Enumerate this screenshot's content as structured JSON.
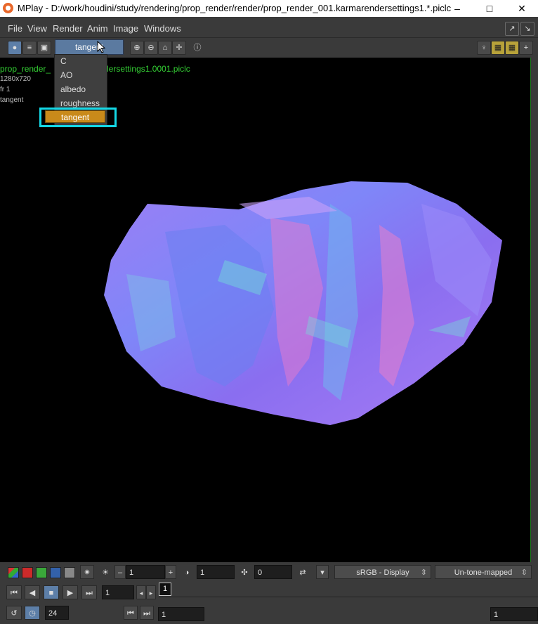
{
  "window": {
    "title": "MPlay - D:/work/houdini/study/rendering/prop_render/render/prop_render_001.karmarendersettings1.*.piclc"
  },
  "menu": [
    "File",
    "View",
    "Render",
    "Anim",
    "Image",
    "Windows"
  ],
  "plane_dropdown": {
    "selected": "tangent",
    "options": [
      "C",
      "AO",
      "albedo",
      "roughness",
      "tangent"
    ]
  },
  "viewport": {
    "filename_left": "prop_render_",
    "filename_right": "dersettings1.0001.piclc",
    "resolution": "1280x720",
    "frame": "fr 1",
    "plane": "tangent"
  },
  "bottom": {
    "gamma_value": "1",
    "exposure_value": "1",
    "offset_value": "0",
    "display_colorspace": "sRGB - Display",
    "tonemap": "Un-tone-mapped",
    "frame_value": "1",
    "timeline_marker": "1",
    "fps": "24",
    "start_frame": "1",
    "end_frame": "1"
  },
  "colors": {
    "accent_orange": "#c98a1a",
    "highlight_cyan": "#14d8e6",
    "file_green": "#34d034"
  }
}
